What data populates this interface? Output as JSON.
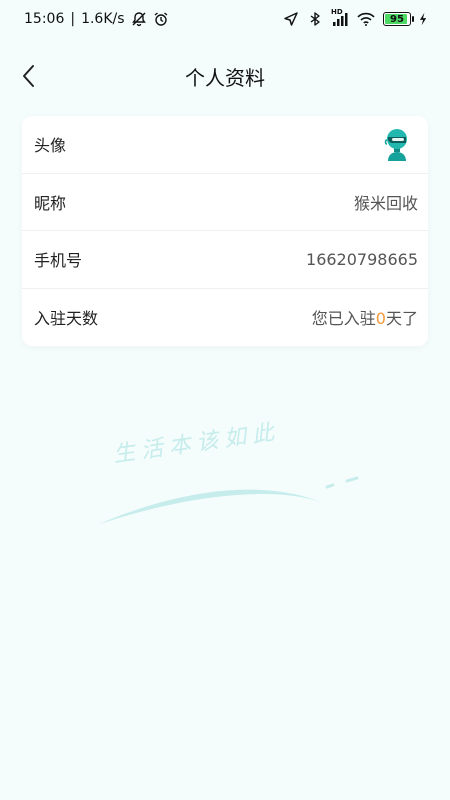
{
  "status_bar": {
    "time": "15:06",
    "separator": "|",
    "speed": "1.6K/s",
    "signal_label": "HD",
    "battery_level": "95"
  },
  "header": {
    "title": "个人资料"
  },
  "profile": {
    "rows": [
      {
        "label": "头像"
      },
      {
        "label": "昵称",
        "value": "猴米回收"
      },
      {
        "label": "手机号",
        "value": "16620798665"
      },
      {
        "label": "入驻天数",
        "value_prefix": "您已入驻",
        "value_days": "0",
        "value_suffix": "天了"
      }
    ]
  },
  "watermark": {
    "slogan": "生活本该如此"
  },
  "colors": {
    "background": "#f4fdfc",
    "accent_orange": "#f39a3b",
    "watermark": "#c6ecec",
    "avatar_teal": "#22b8b0"
  }
}
